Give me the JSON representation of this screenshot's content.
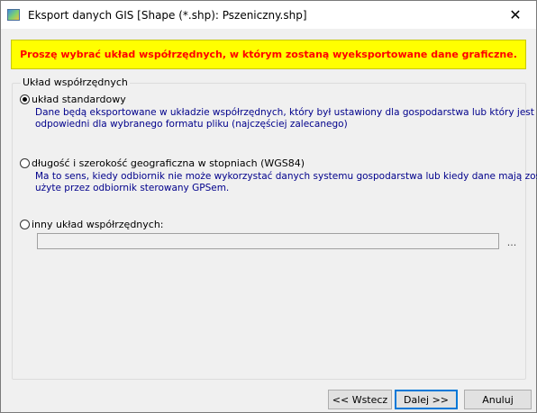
{
  "window": {
    "title": "Eksport danych GIS [Shape (*.shp): Pszeniczny.shp]",
    "close_glyph": "✕"
  },
  "banner": {
    "text": "Proszę wybrać układ współrzędnych, w którym zostaną wyeksportowane dane graficzne.",
    "background": "#ffff00",
    "text_color": "#ff0000"
  },
  "coordinate_group": {
    "legend": "Układ współrzędnych",
    "options": [
      {
        "label": "układ standardowy",
        "checked": true,
        "description": [
          "Dane będą eksportowane w układzie współrzędnych, który był ustawiony dla gospodarstwa lub który jest",
          "odpowiedni dla wybranego formatu pliku (najczęściej zalecanego)"
        ]
      },
      {
        "label": "długość i szerokość geograficzna w stopniach (WGS84)",
        "checked": false,
        "description": [
          "Ma to sens, kiedy odbiornik nie może wykorzystać danych systemu gospodarstwa lub kiedy dane mają zostać",
          "użyte przez odbiornik sterowany GPSem."
        ]
      },
      {
        "label": "inny układ współrzędnych:",
        "checked": false,
        "description": []
      }
    ],
    "custom_path_value": "",
    "browse_label": "..."
  },
  "footer": {
    "back_label": "<< Wstecz",
    "next_label": "Dalej >>",
    "cancel_label": "Anuluj"
  },
  "colors": {
    "description_text": "#00008b",
    "default_button_border": "#0078d7"
  }
}
